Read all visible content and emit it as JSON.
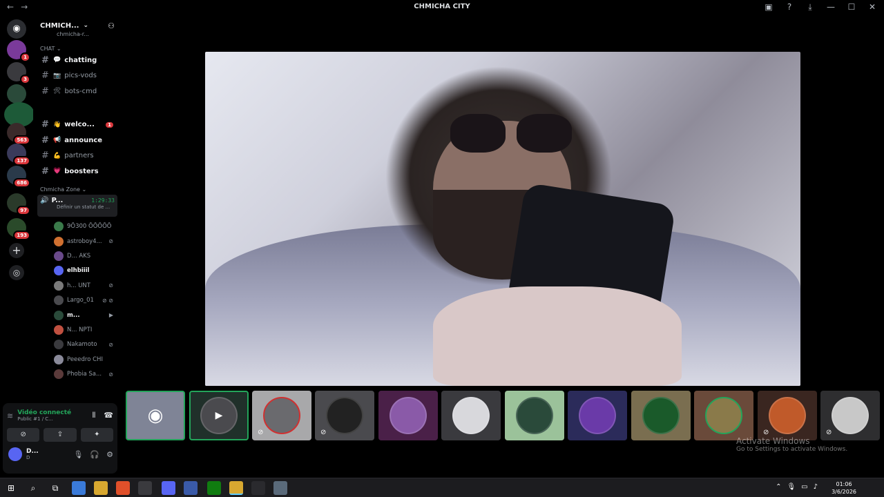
{
  "window": {
    "title": "CHMICHA CITY",
    "back": "←",
    "forward": "→",
    "icons": [
      "inbox-icon",
      "help-icon",
      "download-icon",
      "minimize-icon",
      "maximize-icon",
      "close-icon"
    ],
    "icon_glyphs": [
      "▣",
      "?",
      "⤓",
      "—",
      "☐",
      "✕"
    ]
  },
  "servers": [
    {
      "badge": "1"
    },
    {
      "badge": "3"
    },
    {
      "badge": ""
    },
    {
      "badge": "563"
    },
    {
      "badge": "137"
    },
    {
      "badge": "686"
    },
    {
      "badge": "97"
    },
    {
      "badge": "193"
    }
  ],
  "guild": {
    "name": "CHMICH...",
    "chevron": "⌄",
    "add_people": "⚇"
  },
  "sidebar": {
    "top_partial": "chmicha-r...",
    "cat_chat": "CHAT ⌄",
    "channels": [
      {
        "emoji": "💬",
        "name": "chatting",
        "bold": true,
        "unread": ""
      },
      {
        "emoji": "📷",
        "name": "pics-vods",
        "bold": false,
        "unread": ""
      },
      {
        "emoji": "🛠",
        "name": "bots-cmd",
        "bold": false,
        "unread": ""
      },
      {
        "emoji": "👋",
        "name": "welco...",
        "bold": true,
        "unread": "1"
      },
      {
        "emoji": "📢",
        "name": "announce",
        "bold": true,
        "unread": ""
      },
      {
        "emoji": "💪",
        "name": "partners",
        "bold": false,
        "unread": ""
      },
      {
        "emoji": "💗",
        "name": "boosters",
        "bold": true,
        "unread": ""
      }
    ],
    "cat_zone": "Chmicha Zone ⌄",
    "voice": {
      "name": "P...",
      "time": "1:29:33",
      "status": "Définir un statut de ..."
    },
    "voice_users": [
      {
        "name": "9Ō300 ŌŌŌŌŌ",
        "icon": ""
      },
      {
        "name": "astroboy4...",
        "icon": "⊘"
      },
      {
        "name": "D... AKS",
        "icon": ""
      },
      {
        "name": "elhbiiil",
        "icon": "",
        "white": true
      },
      {
        "name": "h... UNT",
        "icon": "⊘"
      },
      {
        "name": "Largo_01",
        "icon": "⊘ ⊘"
      },
      {
        "name": "m...",
        "icon": "▶",
        "white": true
      },
      {
        "name": "N... NPTI",
        "icon": ""
      },
      {
        "name": "Nakamoto",
        "icon": "⊘"
      },
      {
        "name": "Peeedro CHI",
        "icon": ""
      },
      {
        "name": "Phobia Sa...",
        "icon": "⊘"
      }
    ]
  },
  "panel": {
    "voice_connected": "Vidéo connecté",
    "voice_sub": "Public #1 / C...",
    "user_name": "D...",
    "user_sub": "D"
  },
  "stage_label": "video-feed",
  "tiles": [
    "#9095a8",
    "#2b3a34",
    "#a5a5a8",
    "#4a4a4e",
    "#4a2048",
    "#3a3a3e",
    "#9bc29a",
    "#2b2b5a",
    "#7a6e50",
    "#6a4a3a",
    "#3a2620",
    "#2e2e30"
  ],
  "watermark": {
    "line1": "Activate Windows",
    "line2": "Go to Settings to activate Windows."
  },
  "taskbar": {
    "time": "01:06",
    "date": "3/6/2026"
  }
}
